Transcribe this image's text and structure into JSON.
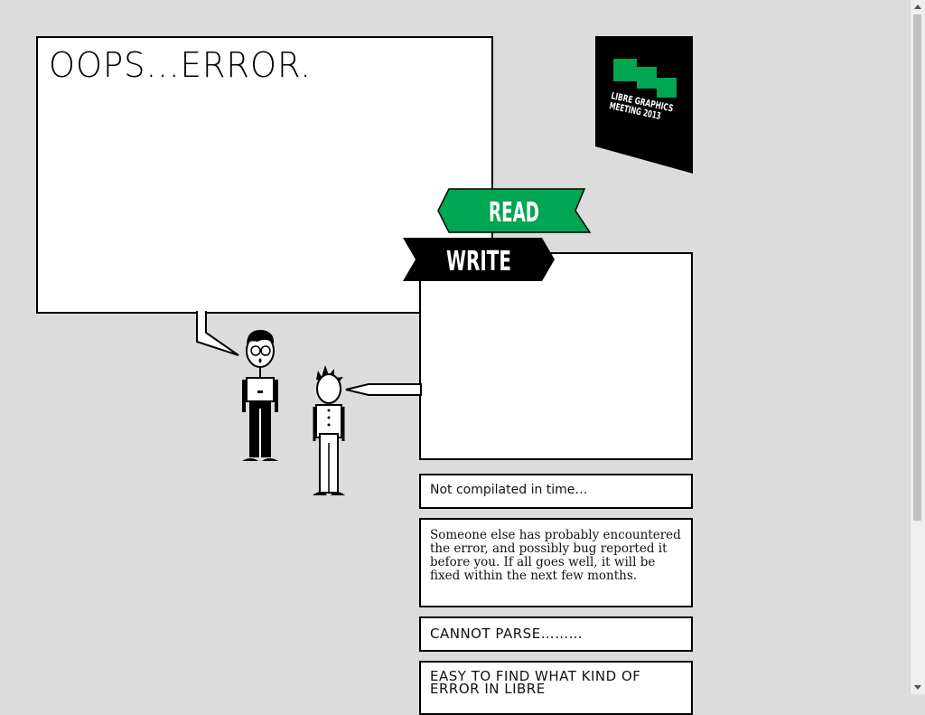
{
  "main": {
    "error_title": "OOPS...ERROR."
  },
  "logo": {
    "line1": "LIBRE GRAPHICS",
    "line2": "MEETING 2013",
    "accent_color": "#00a651"
  },
  "ribbons": {
    "read_label": "READ",
    "read_color": "#00a651",
    "write_label": "WRITE",
    "write_color": "#000000"
  },
  "messages": [
    "Not compilated in time…",
    "Someone else has probably encountered the error, and possibly bug reported it before you. If all goes well, it will be fixed within the next few months.",
    "CANNOT PARSE………",
    "EASY TO FIND WHAT KIND OF ERROR IN LIBRE"
  ]
}
